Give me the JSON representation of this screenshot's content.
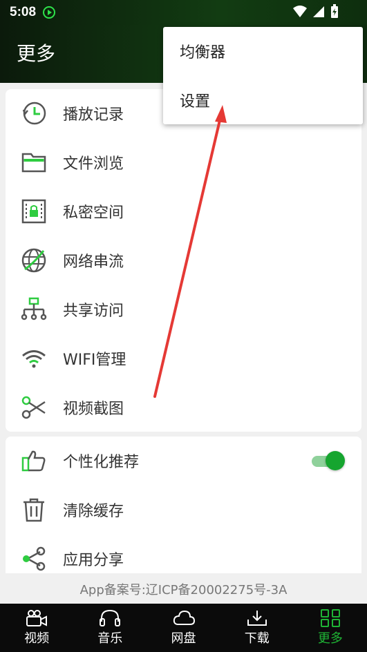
{
  "status_bar": {
    "time": "5:08"
  },
  "app_bar": {
    "title": "更多"
  },
  "menu": {
    "items": [
      {
        "label": "均衡器"
      },
      {
        "label": "设置"
      }
    ]
  },
  "list1": {
    "items": [
      {
        "label": "播放记录",
        "icon": "history-icon"
      },
      {
        "label": "文件浏览",
        "icon": "folder-icon"
      },
      {
        "label": "私密空间",
        "icon": "private-space-icon"
      },
      {
        "label": "网络串流",
        "icon": "globe-icon"
      },
      {
        "label": "共享访问",
        "icon": "network-share-icon"
      },
      {
        "label": "WIFI管理",
        "icon": "wifi-icon"
      },
      {
        "label": "视频截图",
        "icon": "scissors-icon"
      }
    ]
  },
  "list2": {
    "items": [
      {
        "label": "个性化推荐",
        "icon": "thumbs-up-icon",
        "toggle": true
      },
      {
        "label": "清除缓存",
        "icon": "trash-icon"
      },
      {
        "label": "应用分享",
        "icon": "share-icon"
      }
    ]
  },
  "footer": {
    "icp": "App备案号:辽ICP备20002275号-3A"
  },
  "bottom_nav": {
    "items": [
      {
        "label": "视频",
        "icon": "video-camera-icon"
      },
      {
        "label": "音乐",
        "icon": "headphones-icon"
      },
      {
        "label": "网盘",
        "icon": "cloud-icon"
      },
      {
        "label": "下载",
        "icon": "download-icon"
      },
      {
        "label": "更多",
        "icon": "grid-icon",
        "active": true
      }
    ]
  },
  "colors": {
    "accent": "#1fb535",
    "icon_green": "#2ecc40",
    "annotation_arrow": "#e53935"
  }
}
